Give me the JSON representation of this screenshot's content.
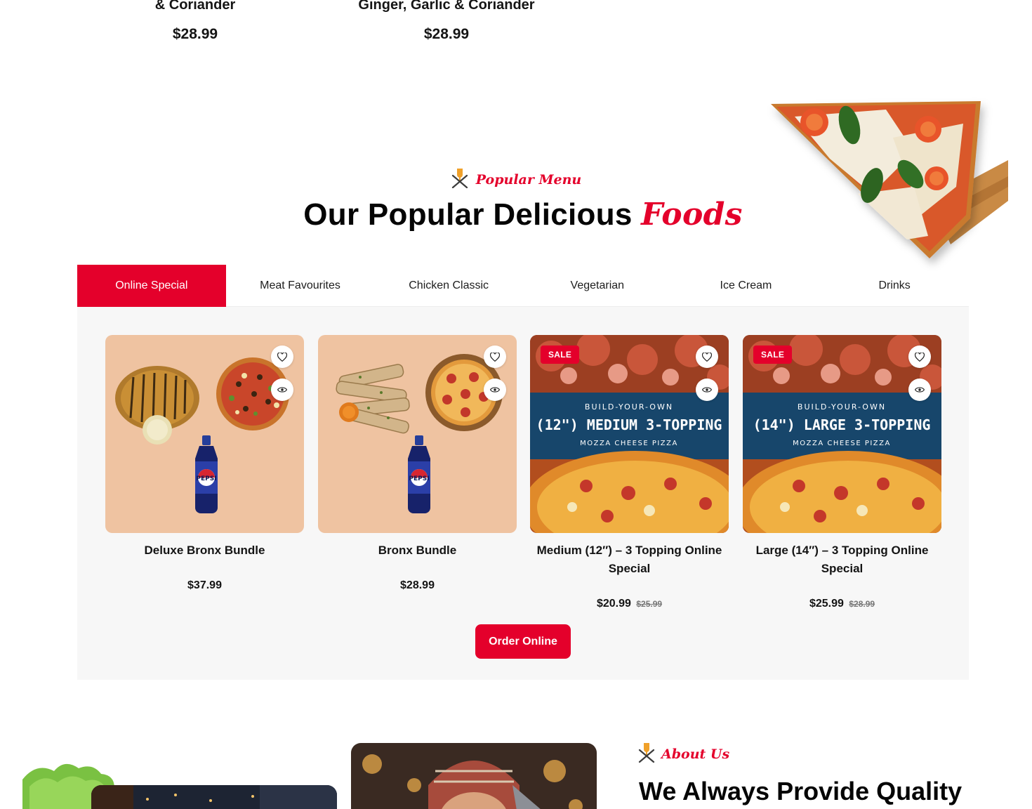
{
  "previous_products": [
    {
      "name": "& Coriander",
      "price": "$28.99"
    },
    {
      "name": "Ginger, Garlic & Coriander",
      "price": "$28.99"
    }
  ],
  "section": {
    "subtitle": "Popular Menu",
    "title_main": "Our Popular Delicious",
    "title_accent": "Foods"
  },
  "tabs": [
    {
      "label": "Online Special",
      "active": true
    },
    {
      "label": "Meat Favourites",
      "active": false
    },
    {
      "label": "Chicken Classic",
      "active": false
    },
    {
      "label": "Vegetarian",
      "active": false
    },
    {
      "label": "Ice Cream",
      "active": false
    },
    {
      "label": "Drinks",
      "active": false
    }
  ],
  "products": [
    {
      "name": "Deluxe Bronx Bundle",
      "price": "$37.99",
      "old_price": "",
      "badge": "",
      "image": "bundle-breadsticks-pizza-pepsi"
    },
    {
      "name": "Bronx Bundle",
      "price": "$28.99",
      "old_price": "",
      "badge": "",
      "image": "bundle-garlic-bread-pepperoni-pepsi"
    },
    {
      "name": "Medium (12″) – 3 Topping Online Special",
      "price": "$20.99",
      "old_price": "$25.99",
      "badge": "SALE",
      "banner": {
        "top": "BUILD-YOUR-OWN",
        "main": "(12\") MEDIUM 3-TOPPING",
        "bottom": "MOZZA CHEESE PIZZA"
      }
    },
    {
      "name": "Large (14″) – 3 Topping Online Special",
      "price": "$25.99",
      "old_price": "$28.99",
      "badge": "SALE",
      "banner": {
        "top": "BUILD-YOUR-OWN",
        "main": "(14\") LARGE 3-TOPPING",
        "bottom": "MOZZA CHEESE PIZZA"
      }
    }
  ],
  "order_button": "Order Online",
  "about": {
    "subtitle": "About Us",
    "title": "We Always Provide Quality"
  },
  "pepsi_label": "PEPSI",
  "colors": {
    "accent": "#e4002b",
    "panel_bg": "#f7f7f7",
    "bundle_bg": "#efc3a1",
    "banner_blue": "#17466b"
  },
  "icons": [
    "chef-fork-knife-icon",
    "heart-icon",
    "eye-icon"
  ]
}
